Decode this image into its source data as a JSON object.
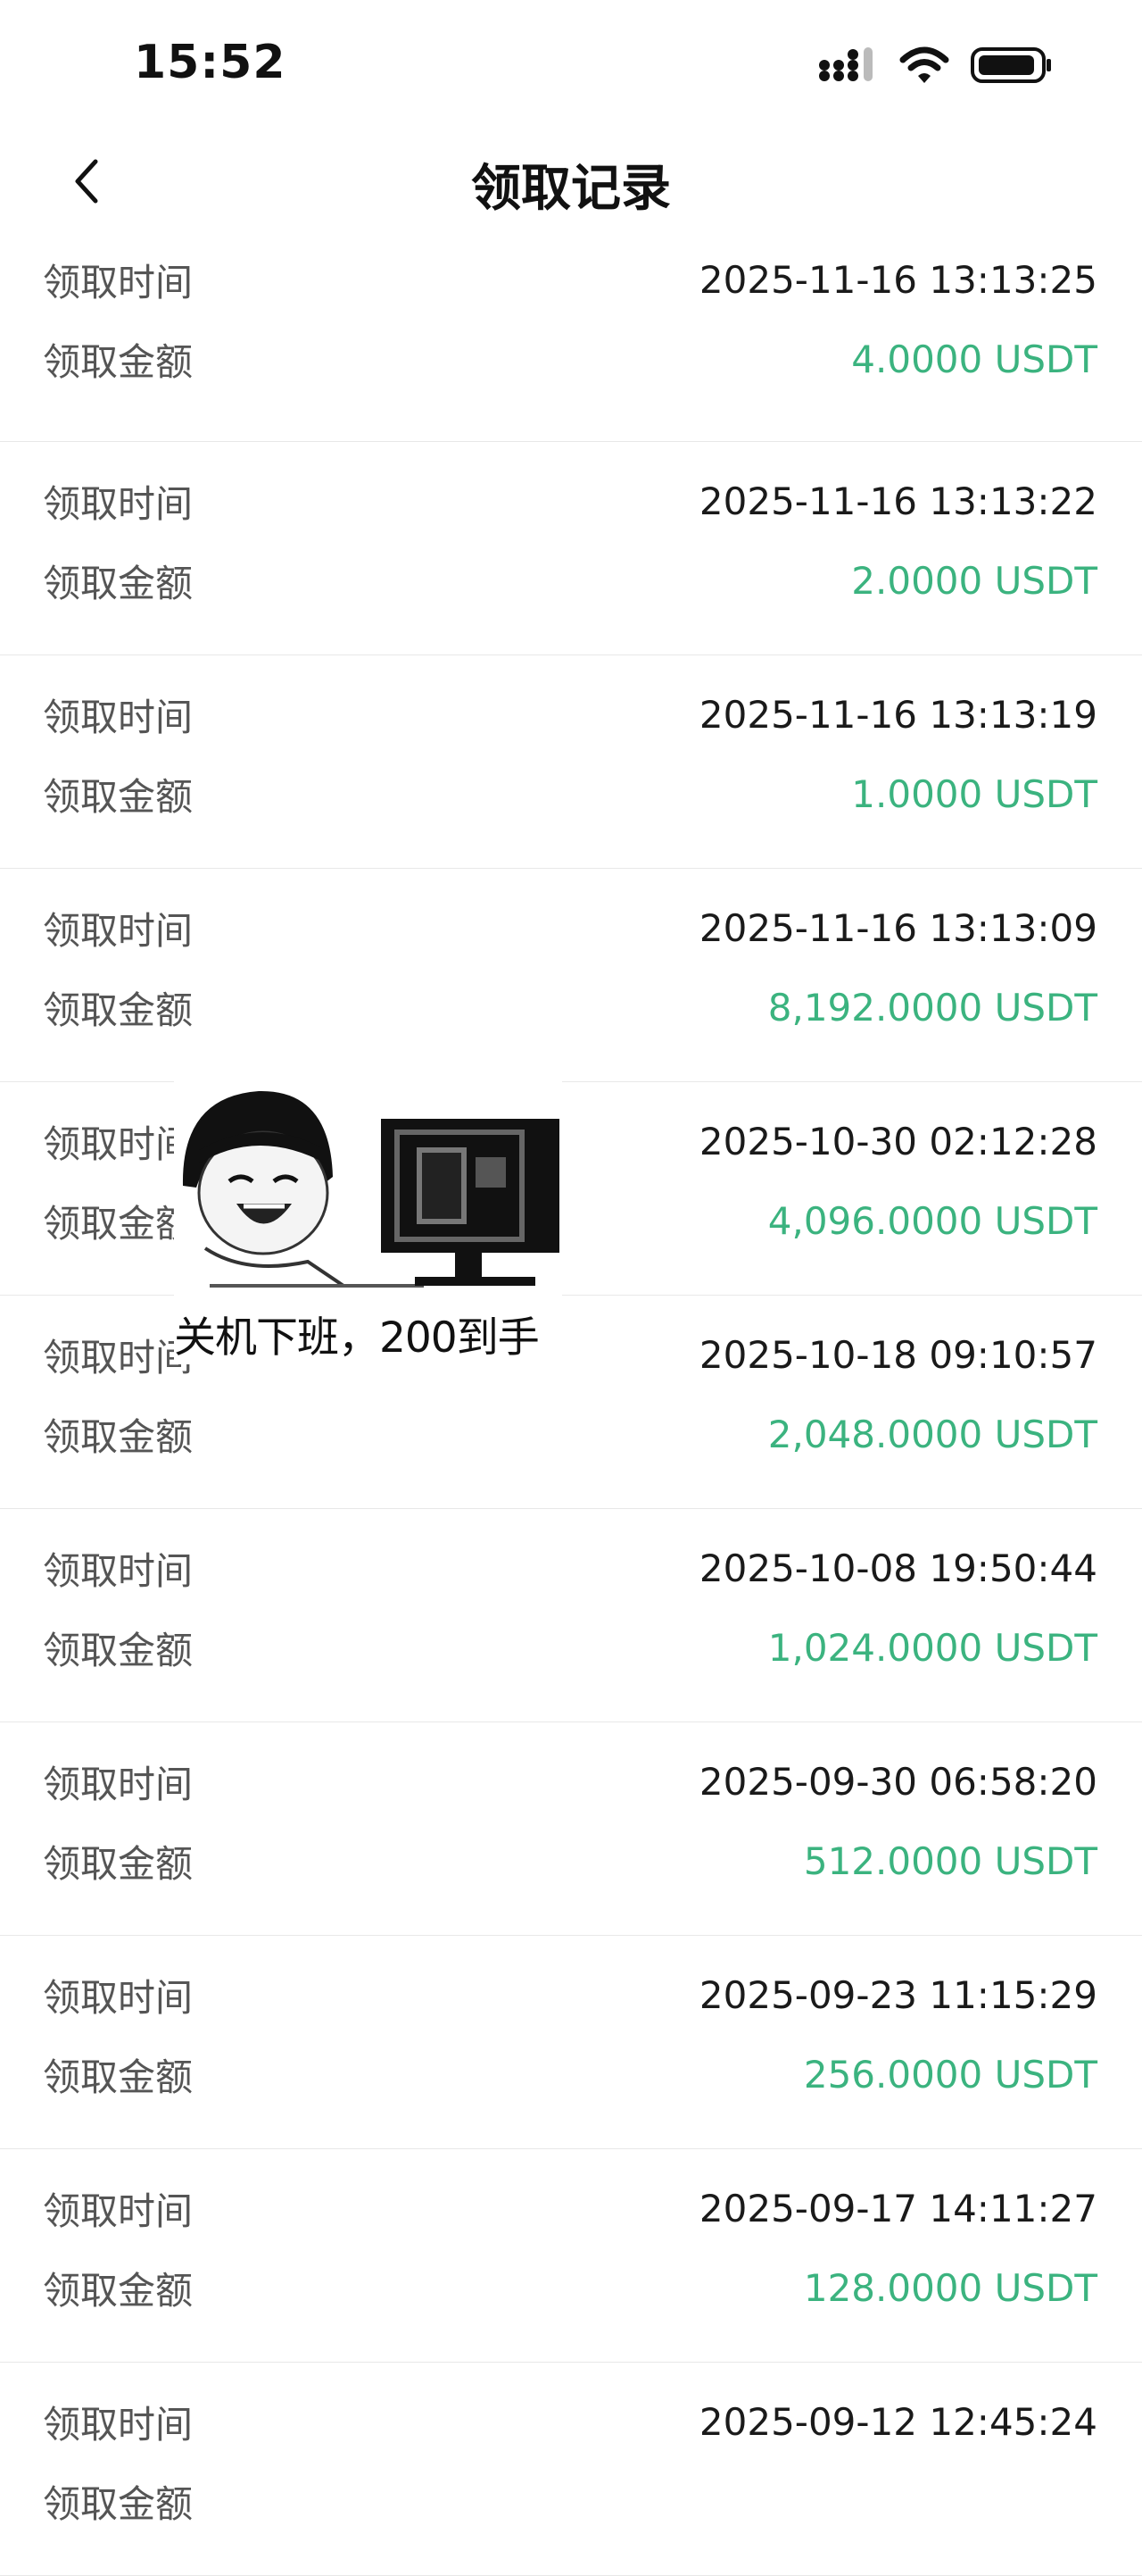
{
  "status_bar": {
    "time": "15:52",
    "icons": [
      "cellular-signal-icon",
      "wifi-icon",
      "battery-icon"
    ]
  },
  "nav": {
    "title": "领取记录",
    "back_icon": "chevron-left-icon"
  },
  "colors": {
    "amount": "#3bb37f",
    "label": "#555555",
    "divider": "#e8e8e8"
  },
  "records": [
    {
      "time_label": "领取时间",
      "time": "2025-11-16 13:13:25",
      "amount_label": "领取金额",
      "amount": "4.0000 USDT"
    },
    {
      "time_label": "领取时间",
      "time": "2025-11-16 13:13:22",
      "amount_label": "领取金额",
      "amount": "2.0000 USDT"
    },
    {
      "time_label": "领取时间",
      "time": "2025-11-16 13:13:19",
      "amount_label": "领取金额",
      "amount": "1.0000 USDT"
    },
    {
      "time_label": "领取时间",
      "time": "2025-11-16 13:13:09",
      "amount_label": "领取金额",
      "amount": "8,192.0000 USDT"
    },
    {
      "time_label": "领取时间",
      "time": "2025-10-30 02:12:28",
      "amount_label": "领取金额",
      "amount": "4,096.0000 USDT"
    },
    {
      "time_label": "领取时间",
      "time": "2025-10-18 09:10:57",
      "amount_label": "领取金额",
      "amount": "2,048.0000 USDT"
    },
    {
      "time_label": "领取时间",
      "time": "2025-10-08 19:50:44",
      "amount_label": "领取金额",
      "amount": "1,024.0000 USDT"
    },
    {
      "time_label": "领取时间",
      "time": "2025-09-30 06:58:20",
      "amount_label": "领取金额",
      "amount": "512.0000 USDT"
    },
    {
      "time_label": "领取时间",
      "time": "2025-09-23 11:15:29",
      "amount_label": "领取金额",
      "amount": "256.0000 USDT"
    },
    {
      "time_label": "领取时间",
      "time": "2025-09-17 14:11:27",
      "amount_label": "领取金额",
      "amount": "128.0000 USDT"
    },
    {
      "time_label": "领取时间",
      "time": "2025-09-12 12:45:24",
      "amount_label": "领取金额",
      "amount": ""
    }
  ],
  "meme": {
    "caption": "关机下班，200到手"
  }
}
